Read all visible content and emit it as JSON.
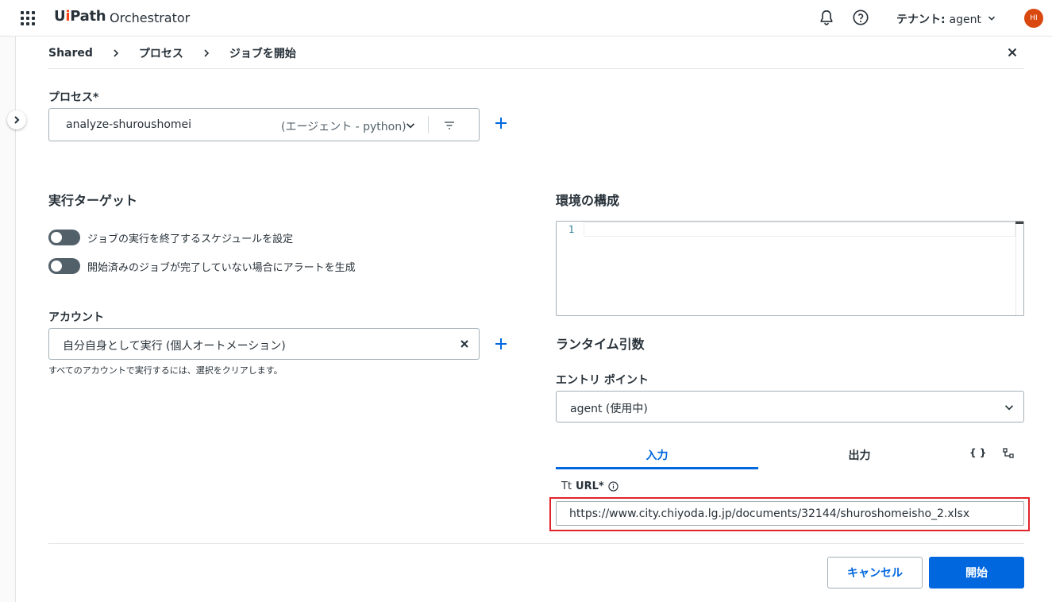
{
  "header": {
    "brand_ui": "Ui",
    "brand_path": "Path",
    "product": "Orchestrator",
    "tenant_label": "テナント:",
    "tenant_value": "agent",
    "avatar_initials": "HI"
  },
  "breadcrumb": [
    "Shared",
    "プロセス",
    "ジョブを開始"
  ],
  "form": {
    "process_label": "プロセス*",
    "process_name": "analyze-shuroushomei",
    "process_type": "(エージェント - python)",
    "execution_target_title": "実行ターゲット",
    "toggle_schedule": "ジョブの実行を終了するスケジュールを設定",
    "toggle_alert": "開始済みのジョブが完了していない場合にアラートを生成",
    "account_label": "アカウント",
    "account_value": "自分自身として実行 (個人オートメーション)",
    "account_hint": "すべてのアカウントで実行するには、選択をクリアします。",
    "env_title": "環境の構成",
    "editor_line": "1",
    "runtime_title": "ランタイム引数",
    "entry_label": "エントリ ポイント",
    "entry_value": "agent (使用中)",
    "tab_input": "入力",
    "tab_output": "出力",
    "braces": "{ }",
    "url_type": "Tt",
    "url_label": "URL*",
    "url_value": "https://www.city.chiyoda.lg.jp/documents/32144/shuroshomeisho_2.xlsx"
  },
  "footer": {
    "cancel": "キャンセル",
    "start": "開始"
  },
  "colors": {
    "accent": "#0067df",
    "highlight": "#e0242b",
    "brand_orange": "#fa4616"
  }
}
